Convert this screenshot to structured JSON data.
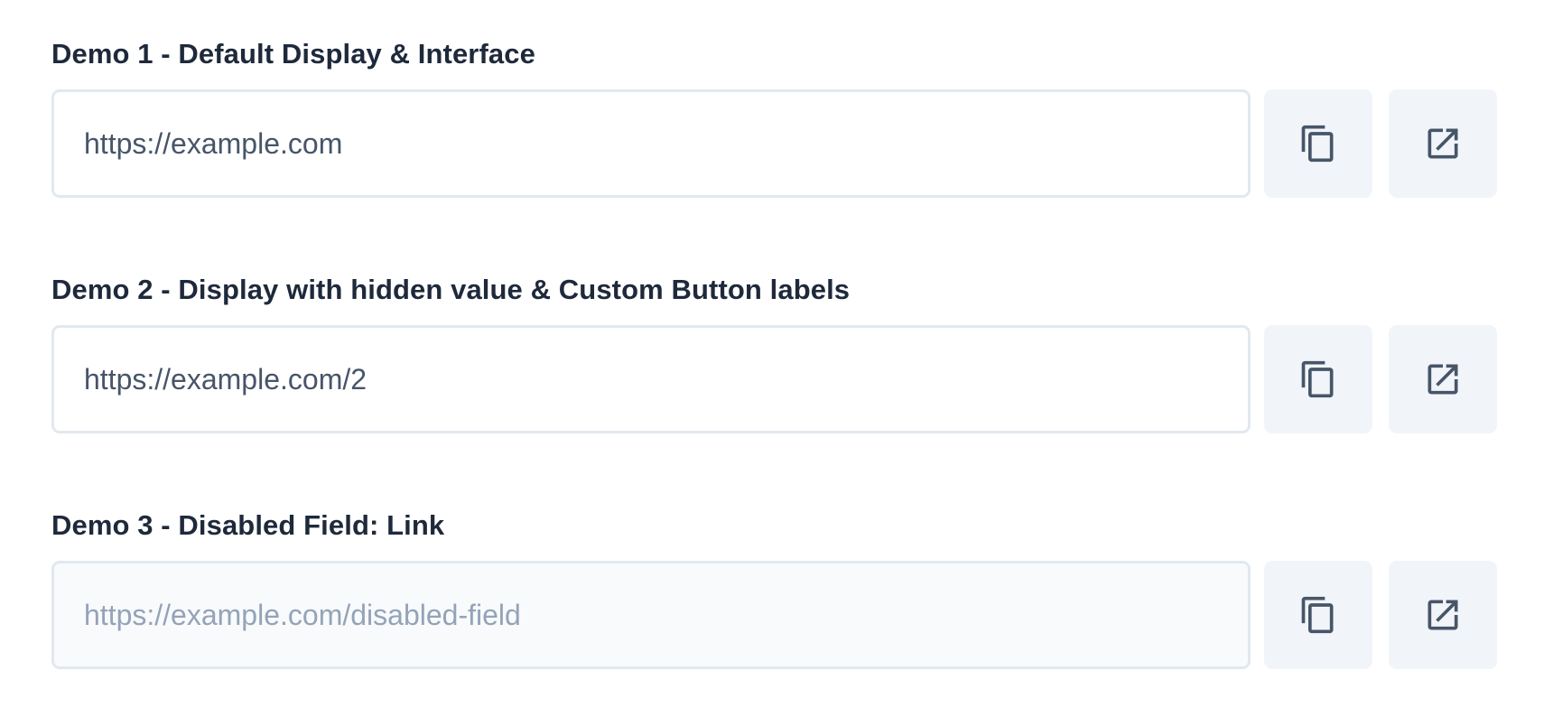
{
  "colors": {
    "label": "#1e293b",
    "field_border": "#e2e8f0",
    "field_text": "#475569",
    "field_disabled_text": "#94a3b8",
    "field_disabled_bg": "#f8fafc",
    "button_bg": "#f1f5f9",
    "icon": "#475569"
  },
  "demos": [
    {
      "label": "Demo 1 - Default Display & Interface",
      "value": "https://example.com",
      "disabled": false,
      "buttons": [
        {
          "icon": "copy-icon"
        },
        {
          "icon": "open-external-icon"
        }
      ]
    },
    {
      "label": "Demo 2 - Display with hidden value & Custom Button labels",
      "value": "https://example.com/2",
      "disabled": false,
      "buttons": [
        {
          "icon": "copy-icon"
        },
        {
          "icon": "open-external-icon"
        }
      ]
    },
    {
      "label": "Demo 3 - Disabled Field: Link",
      "value": "https://example.com/disabled-field",
      "disabled": true,
      "buttons": [
        {
          "icon": "copy-icon"
        },
        {
          "icon": "open-external-icon"
        }
      ]
    }
  ]
}
